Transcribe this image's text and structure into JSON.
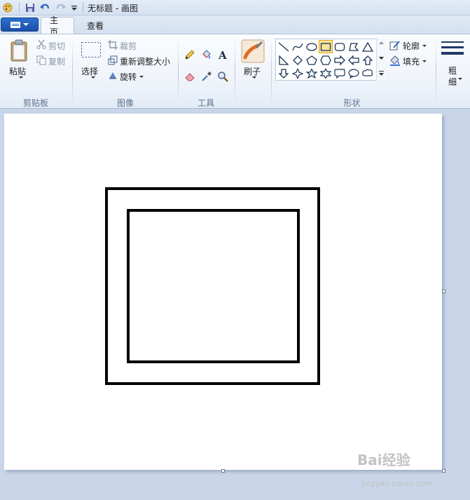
{
  "window": {
    "title": "无标题 - 画图"
  },
  "tabs": [
    {
      "label": "主页",
      "active": true
    },
    {
      "label": "查看",
      "active": false
    }
  ],
  "groups": {
    "clipboard": {
      "label": "剪贴板",
      "paste": "粘贴",
      "cut": "剪切",
      "copy": "复制"
    },
    "image": {
      "label": "图像",
      "select": "选择",
      "crop": "裁剪",
      "resize": "重新调整大小",
      "rotate": "旋转"
    },
    "tools": {
      "label": "工具"
    },
    "brushes": {
      "label": "刷子"
    },
    "shapes": {
      "label": "形状",
      "outline": "轮廓",
      "fill": "填充"
    },
    "size": {
      "label": "粗细"
    }
  },
  "watermark": {
    "brand": "Bai经验",
    "url": "jingyan.baidu.com"
  },
  "colors": {
    "accent": "#2b6fd1",
    "selected_shape": "#fde49a",
    "ribbon_text": "#1e395b"
  }
}
